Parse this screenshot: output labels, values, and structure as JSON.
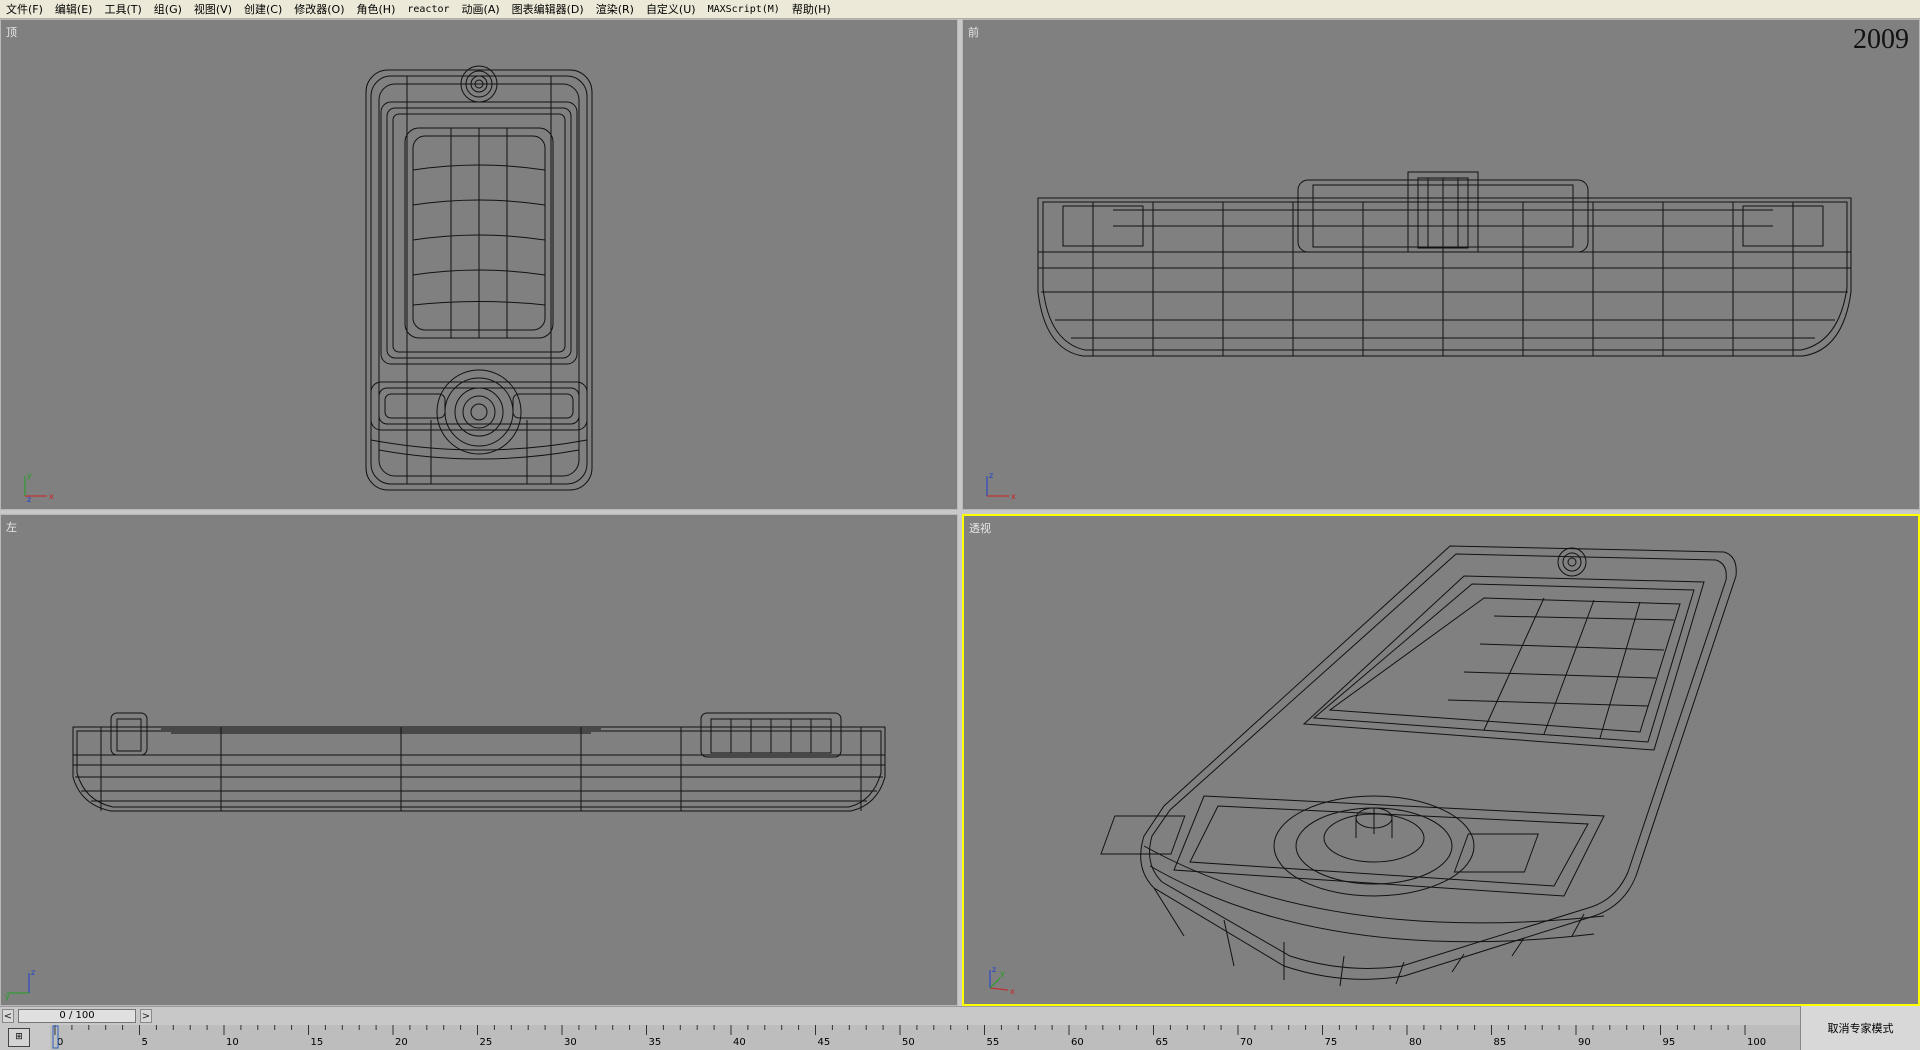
{
  "menubar": {
    "items": [
      {
        "label": "文件(F)"
      },
      {
        "label": "编辑(E)"
      },
      {
        "label": "工具(T)"
      },
      {
        "label": "组(G)"
      },
      {
        "label": "视图(V)"
      },
      {
        "label": "创建(C)"
      },
      {
        "label": "修改器(O)"
      },
      {
        "label": "角色(H)"
      },
      {
        "label": "reactor"
      },
      {
        "label": "动画(A)"
      },
      {
        "label": "图表编辑器(D)"
      },
      {
        "label": "渲染(R)"
      },
      {
        "label": "自定义(U)"
      },
      {
        "label": "MAXScript(M)"
      },
      {
        "label": "帮助(H)"
      }
    ]
  },
  "viewports": {
    "top": {
      "label": "顶"
    },
    "front": {
      "label": "前",
      "year": "2009"
    },
    "left": {
      "label": "左"
    },
    "perspective": {
      "label": "透视"
    }
  },
  "axis_labels": {
    "x": "x",
    "y": "y",
    "z": "z"
  },
  "timeslider": {
    "frame_text": "0 / 100",
    "prev": "<",
    "next": ">"
  },
  "trackbar": {
    "ticks": [
      "0",
      "5",
      "10",
      "15",
      "20",
      "25",
      "30",
      "35",
      "40",
      "45",
      "50",
      "55",
      "60",
      "65",
      "70",
      "75",
      "80",
      "85",
      "90",
      "95",
      "100"
    ],
    "current_frame": 0
  },
  "expert_mode": {
    "label": "取消专家模式"
  },
  "colors": {
    "viewport_bg": "#808080",
    "active_border": "#ffff00",
    "wire": "#111111",
    "axis_x": "#d02020",
    "axis_y": "#20a020",
    "axis_z": "#2040d0"
  }
}
